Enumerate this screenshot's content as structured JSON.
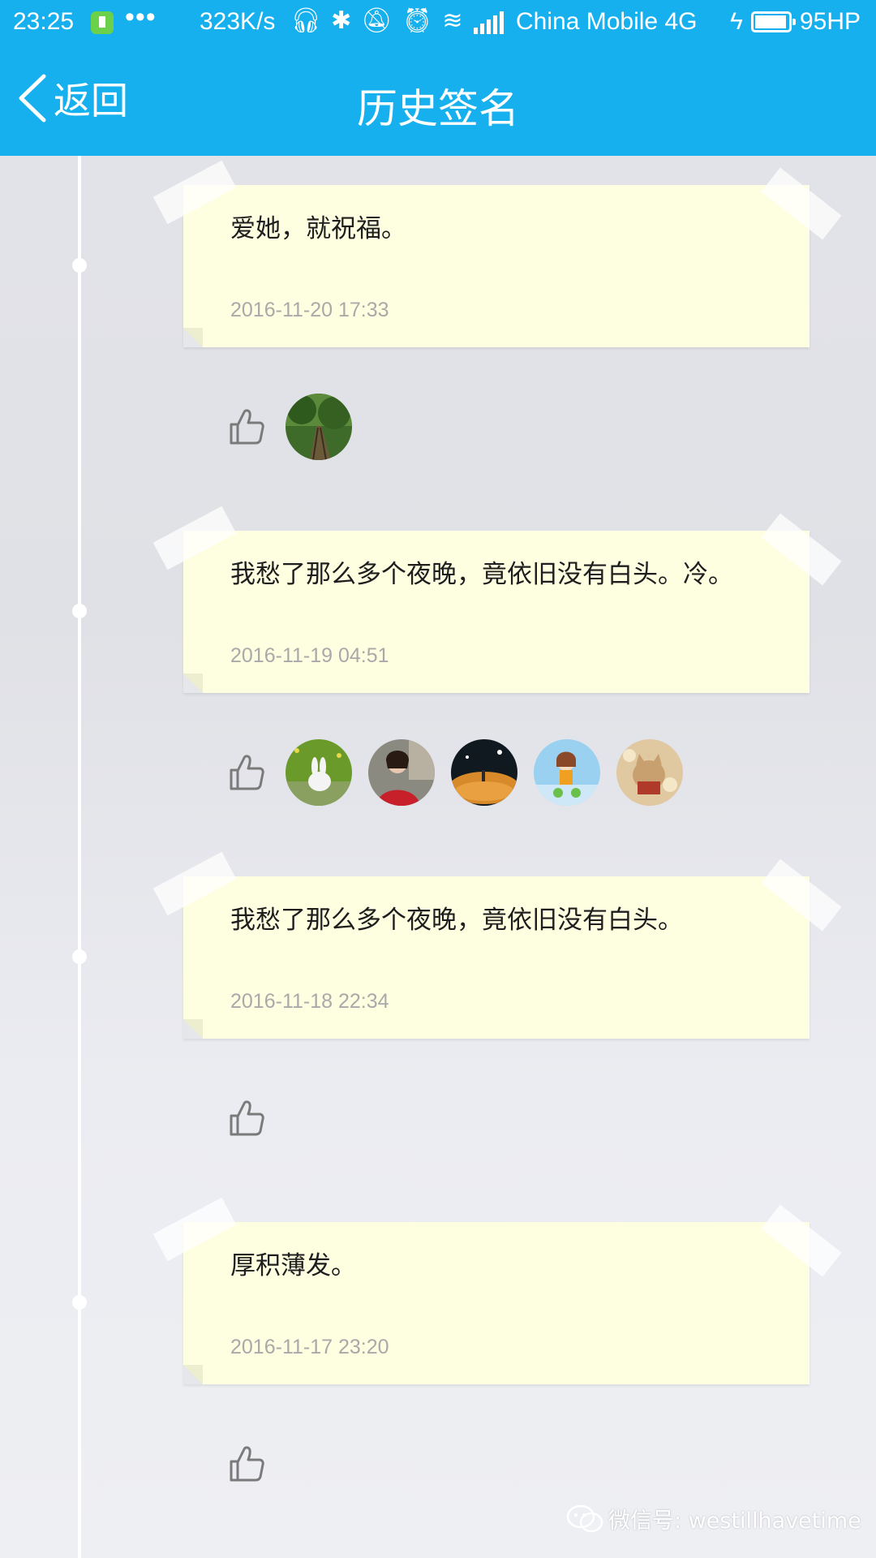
{
  "status_bar": {
    "time": "23:25",
    "dots": "•••",
    "speed": "323K/s",
    "carrier": "China Mobile",
    "network": "4G",
    "battery": "95HP",
    "icons": [
      "headphones-icon",
      "bluetooth-icon",
      "vibrate-off-icon",
      "alarm-icon",
      "wifi-icon",
      "signal-icon",
      "charging-icon",
      "battery-icon"
    ]
  },
  "nav": {
    "back_label": "返回",
    "title": "历史签名"
  },
  "colors": {
    "brand_blue": "#16b0ef",
    "note_yellow": "#fefee0",
    "date_grey": "#a9a9a9"
  },
  "signatures": [
    {
      "text": "爱她，就祝福。",
      "date": "2016-11-20 17:33",
      "likes": [
        "forest-railway-avatar"
      ]
    },
    {
      "text": "我愁了那么多个夜晚，竟依旧没有白头。冷。",
      "date": "2016-11-19 04:51",
      "likes": [
        "white-rabbit-avatar",
        "girl-red-jacket-avatar",
        "night-field-avatar",
        "cartoon-girl-avatar",
        "kitten-avatar"
      ]
    },
    {
      "text": "我愁了那么多个夜晚，竟依旧没有白头。",
      "date": "2016-11-18 22:34",
      "likes": []
    },
    {
      "text": "厚积薄发。",
      "date": "2016-11-17 23:20",
      "likes": []
    }
  ],
  "watermark": {
    "text": "微信号: westillhavetime"
  }
}
